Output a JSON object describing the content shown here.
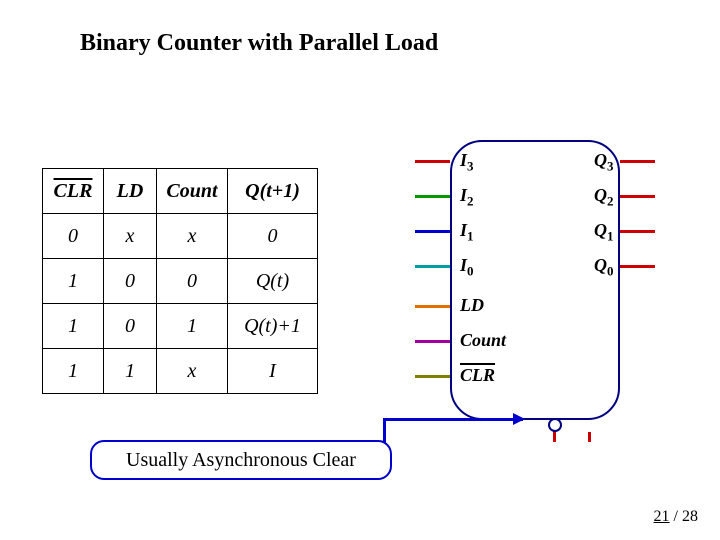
{
  "title": "Binary Counter with Parallel Load",
  "table": {
    "headers": {
      "clr": "CLR",
      "ld": "LD",
      "count": "Count",
      "q": "Q(t+1)"
    },
    "rows": [
      {
        "clr": "0",
        "ld": "x",
        "count": "x",
        "q": "0"
      },
      {
        "clr": "1",
        "ld": "0",
        "count": "0",
        "q": "Q(t)"
      },
      {
        "clr": "1",
        "ld": "0",
        "count": "1",
        "q": "Q(t)+1"
      },
      {
        "clr": "1",
        "ld": "1",
        "count": "x",
        "q": "I"
      }
    ]
  },
  "block": {
    "inputs": [
      "I",
      "I",
      "I",
      "I"
    ],
    "in_sub": [
      "3",
      "2",
      "1",
      "0"
    ],
    "outputs": [
      "Q",
      "Q",
      "Q",
      "Q"
    ],
    "out_sub": [
      "3",
      "2",
      "1",
      "0"
    ],
    "ctrl": {
      "ld": "LD",
      "count": "Count",
      "clr": "CLR"
    }
  },
  "wire_colors": [
    "#cc0000",
    "#009900",
    "#0000cc",
    "#00a0a0",
    "#e07000",
    "#a000a0",
    "#808000"
  ],
  "callout": "Usually Asynchronous Clear",
  "page": {
    "current": "21",
    "sep": " / ",
    "total": "28"
  }
}
